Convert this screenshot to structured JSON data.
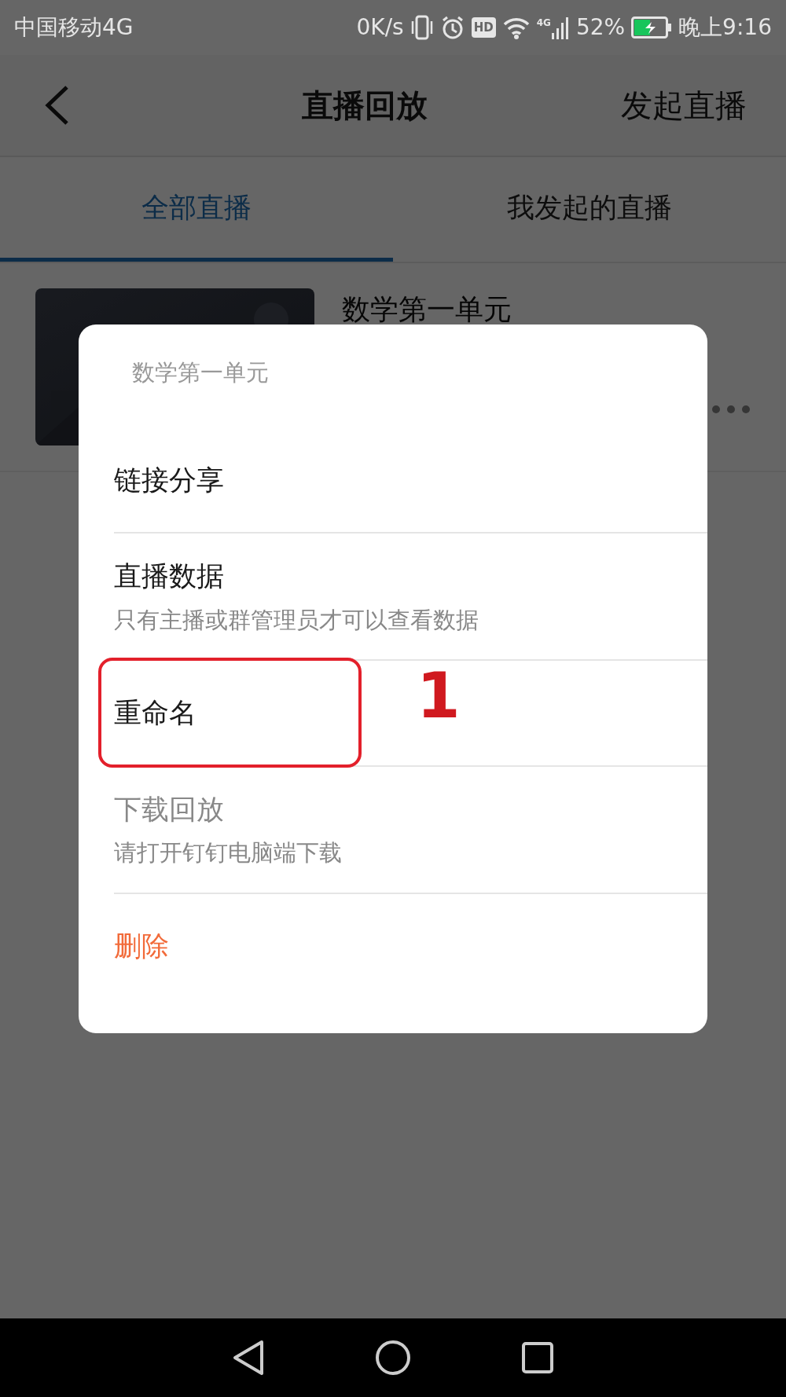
{
  "status_bar": {
    "carrier": "中国移动4G",
    "speed": "0K/s",
    "hd_badge": "HD",
    "network_type": "4G",
    "battery_percent": "52%",
    "charging": true,
    "time": "晚上9:16"
  },
  "header": {
    "title": "直播回放",
    "action": "发起直播"
  },
  "tabs": [
    {
      "label": "全部直播",
      "selected": true
    },
    {
      "label": "我发起的直播",
      "selected": false
    }
  ],
  "list": [
    {
      "title": "数学第一单元",
      "kind": "picture"
    }
  ],
  "dialog": {
    "title": "数学第一单元",
    "items": [
      {
        "label": "链接分享",
        "kind": "normal",
        "disabled": false,
        "highlighted": false
      },
      {
        "label": "直播数据",
        "subtitle": "只有主播或群管理员才可以查看数据",
        "kind": "normal",
        "disabled": false,
        "highlighted": false
      },
      {
        "label": "重命名",
        "kind": "normal",
        "disabled": false,
        "highlighted": true
      },
      {
        "label": "下载回放",
        "subtitle": "请打开钉钉电脑端下载",
        "kind": "normal",
        "disabled": true,
        "highlighted": false
      },
      {
        "label": "删除",
        "kind": "danger",
        "disabled": false,
        "highlighted": false
      }
    ]
  },
  "annotation": {
    "label": "1"
  }
}
